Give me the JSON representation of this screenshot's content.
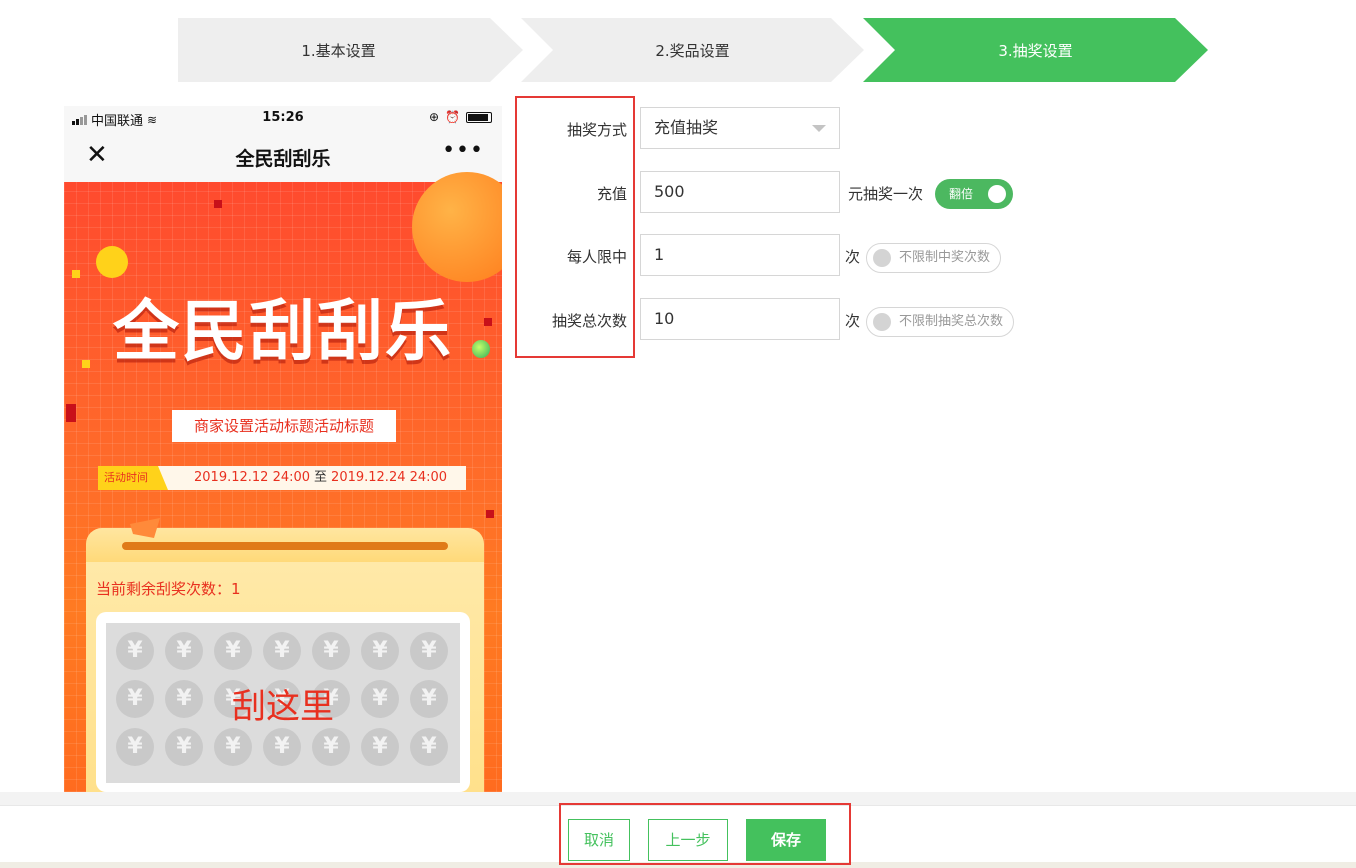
{
  "steps": [
    {
      "label": "1.基本设置",
      "active": false
    },
    {
      "label": "2.奖品设置",
      "active": false
    },
    {
      "label": "3.抽奖设置",
      "active": true
    }
  ],
  "phone": {
    "status": {
      "carrier": "中国联通",
      "time": "15:26"
    },
    "nav_title": "全民刮刮乐",
    "close_glyph": "✕",
    "more_glyph": "•••",
    "poster_title": "全民刮刮乐",
    "activity_title": "商家设置活动标题活动标题",
    "time_tag": "活动时间",
    "time_start": "2019.12.12 24:00",
    "time_sep": "至",
    "time_end": "2019.12.24 24:00",
    "remaining_label": "当前剩余刮奖次数：1",
    "coin_glyph": "¥",
    "scratch_label": "刮这里"
  },
  "form": {
    "method": {
      "label": "抽奖方式",
      "value": "充值抽奖"
    },
    "recharge": {
      "label": "充值",
      "value": "500",
      "suffix": "元抽奖一次",
      "toggle_label": "翻倍",
      "toggle_on": true
    },
    "per_person": {
      "label": "每人限中",
      "value": "1",
      "suffix": "次",
      "toggle_label": "不限制中奖次数",
      "toggle_on": false
    },
    "total": {
      "label": "抽奖总次数",
      "value": "10",
      "suffix": "次",
      "toggle_label": "不限制抽奖总次数",
      "toggle_on": false
    }
  },
  "buttons": {
    "cancel": "取消",
    "prev": "上一步",
    "save": "保存"
  },
  "colors": {
    "accent": "#44c15d",
    "highlight": "#e53935",
    "poster": "#ff4a2e"
  }
}
